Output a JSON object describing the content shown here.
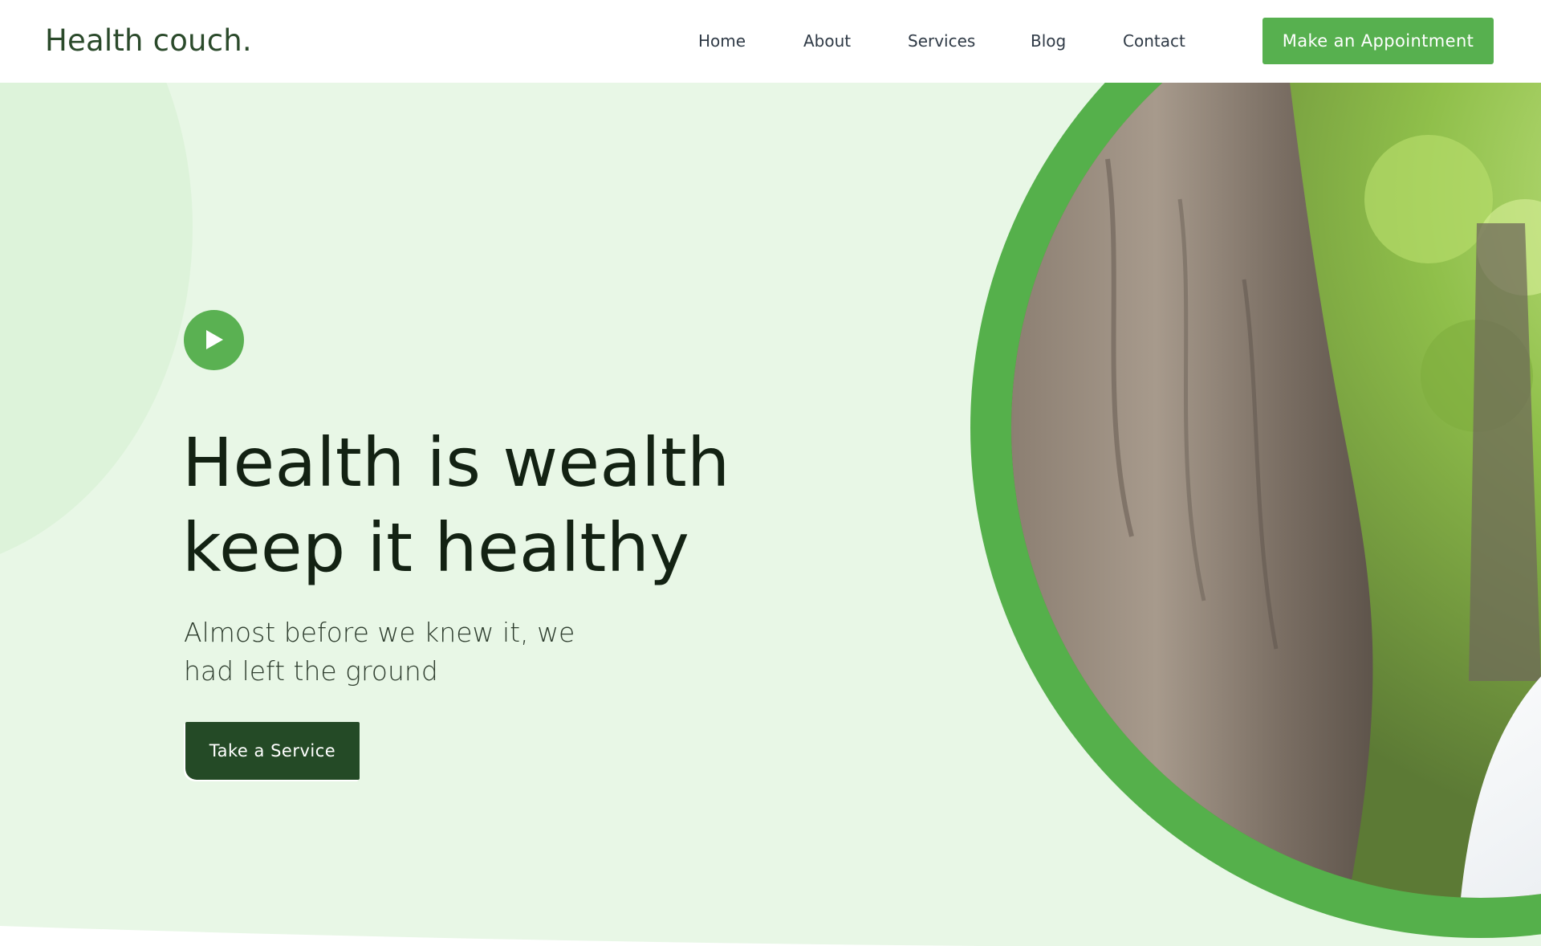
{
  "header": {
    "logo": "Health couch.",
    "nav": [
      {
        "label": "Home"
      },
      {
        "label": "About"
      },
      {
        "label": "Services"
      },
      {
        "label": "Blog"
      },
      {
        "label": "Contact"
      }
    ],
    "cta_label": "Make an Appointment"
  },
  "hero": {
    "headline_line1": "Health is wealth",
    "headline_line2": "keep it healthy",
    "subhead_line1": "Almost before we knew it, we",
    "subhead_line2": "had left the ground",
    "button_label": "Take a Service",
    "play_icon": "play-icon"
  },
  "colors": {
    "brand_green": "#57b04f",
    "dark_green": "#244a26",
    "hero_bg": "#e8f7e6",
    "text_dark": "#132213"
  }
}
